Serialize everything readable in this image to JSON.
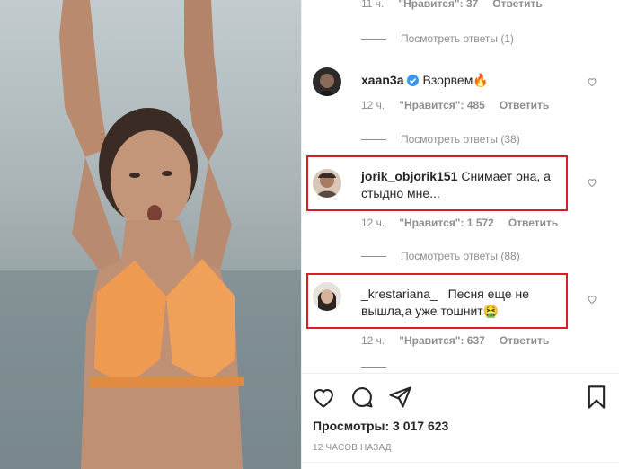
{
  "comments": [
    {
      "username": "",
      "text": "",
      "meta_time": "11 ч.",
      "likes_label": "\"Нравится\": 37",
      "reply_label": "Ответить",
      "view_replies": "Посмотреть ответы (1)"
    },
    {
      "username": "xaan3a",
      "verified": true,
      "text": "Взорвем🔥",
      "meta_time": "12 ч.",
      "likes_label": "\"Нравится\": 485",
      "reply_label": "Ответить",
      "view_replies": "Посмотреть ответы (38)"
    },
    {
      "username": "jorik_objorik151",
      "text_line1": "Снимает она, а",
      "text_line2": "стыдно мне...",
      "meta_time": "12 ч.",
      "likes_label": "\"Нравится\": 1 572",
      "reply_label": "Ответить",
      "view_replies": "Посмотреть ответы (88)"
    },
    {
      "username": "_krestariana_",
      "text_line1": "Песня еще не",
      "text_line2": "вышла,а уже тошнит🤮",
      "meta_time": "12 ч.",
      "likes_label": "\"Нравится\": 637",
      "reply_label": "Ответить"
    }
  ],
  "actions": {
    "like_icon": "heart-outline-icon",
    "comment_icon": "comment-bubble-icon",
    "share_icon": "paper-plane-icon",
    "save_icon": "bookmark-icon"
  },
  "views_label": "Просмотры: 3 017 623",
  "timestamp": "12 ЧАСОВ НАЗАД",
  "colors": {
    "highlight": "#d81f26",
    "verified": "#3897f0",
    "muted": "#8e8e8e",
    "text": "#262626"
  }
}
